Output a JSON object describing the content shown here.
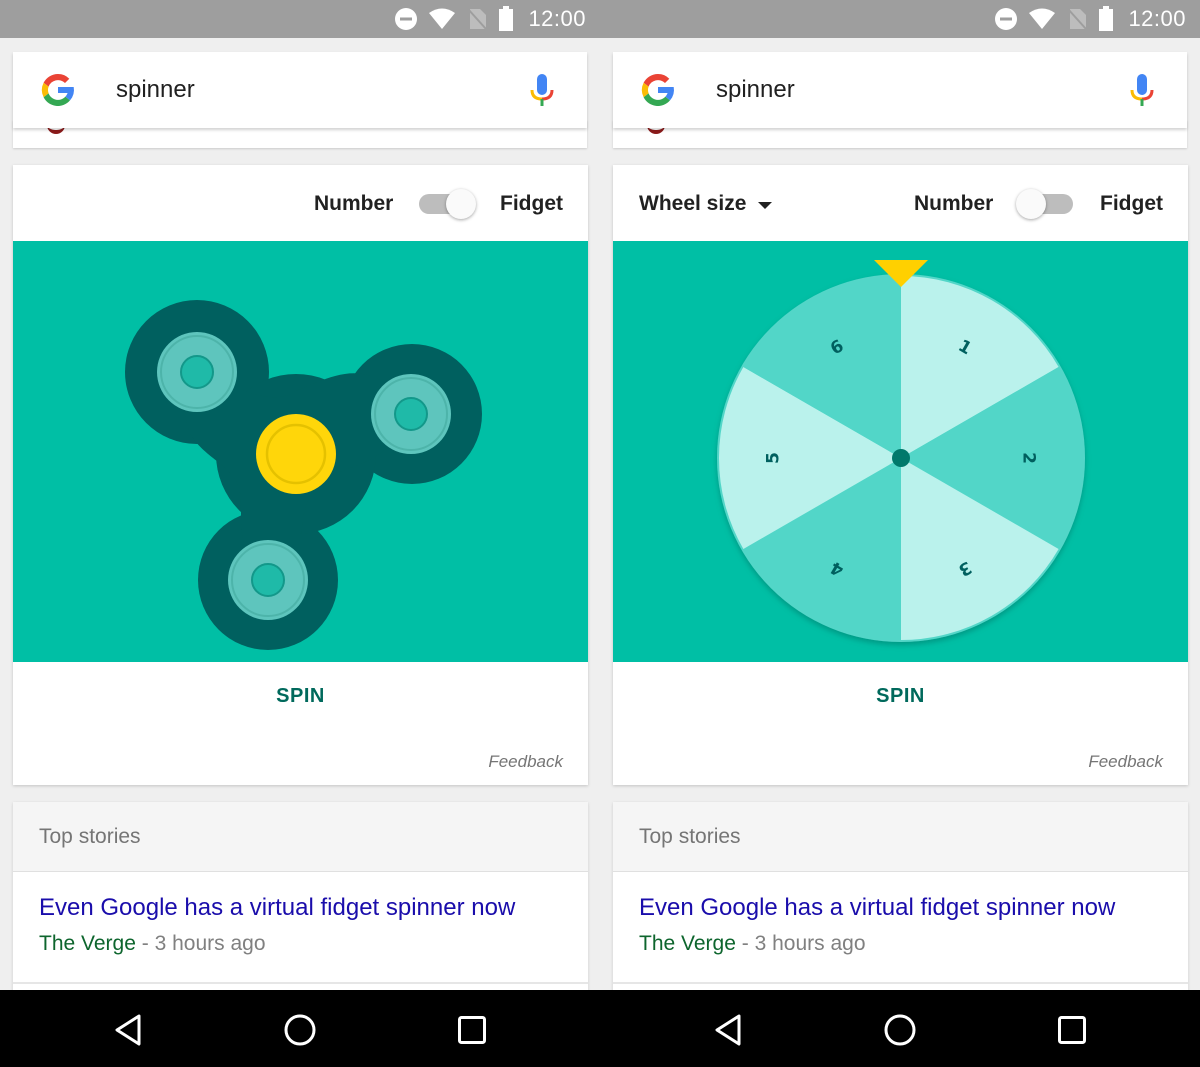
{
  "status_bar": {
    "time": "12:00",
    "icons": [
      "do-not-disturb-icon",
      "wifi-icon",
      "no-sim-icon",
      "battery-icon"
    ]
  },
  "search": {
    "query": "spinner",
    "logo": "google-g-icon",
    "mic": "microphone-icon"
  },
  "screens": [
    {
      "mode": "fidget",
      "controls": {
        "toggle_left_label": "Number",
        "toggle_right_label": "Fidget",
        "toggle_on": true
      },
      "spin_label": "SPIN",
      "feedback_label": "Feedback"
    },
    {
      "mode": "number",
      "controls": {
        "dropdown_label": "Wheel size",
        "toggle_left_label": "Number",
        "toggle_right_label": "Fidget",
        "toggle_on": false
      },
      "wheel": {
        "segments": [
          "1",
          "2",
          "3",
          "4",
          "5",
          "6"
        ]
      },
      "spin_label": "SPIN",
      "feedback_label": "Feedback"
    }
  ],
  "top_stories": {
    "header": "Top stories",
    "story": {
      "title": "Even Google has a virtual fidget spinner now",
      "source": "The Verge",
      "separator": " - ",
      "age": "3 hours ago"
    }
  },
  "colors": {
    "stage_bg": "#00bfa5",
    "spinner_body": "#00605f",
    "spinner_cap": "#ffd60a",
    "wheel_light": "#baf2ec",
    "wheel_dark": "#52d6c8",
    "pointer": "#ffd000",
    "spin_button": "#00695c",
    "link": "#1a0dab",
    "source": "#0d652d"
  },
  "nav_bar": {
    "buttons": [
      "back-icon",
      "home-icon",
      "recents-icon"
    ]
  }
}
